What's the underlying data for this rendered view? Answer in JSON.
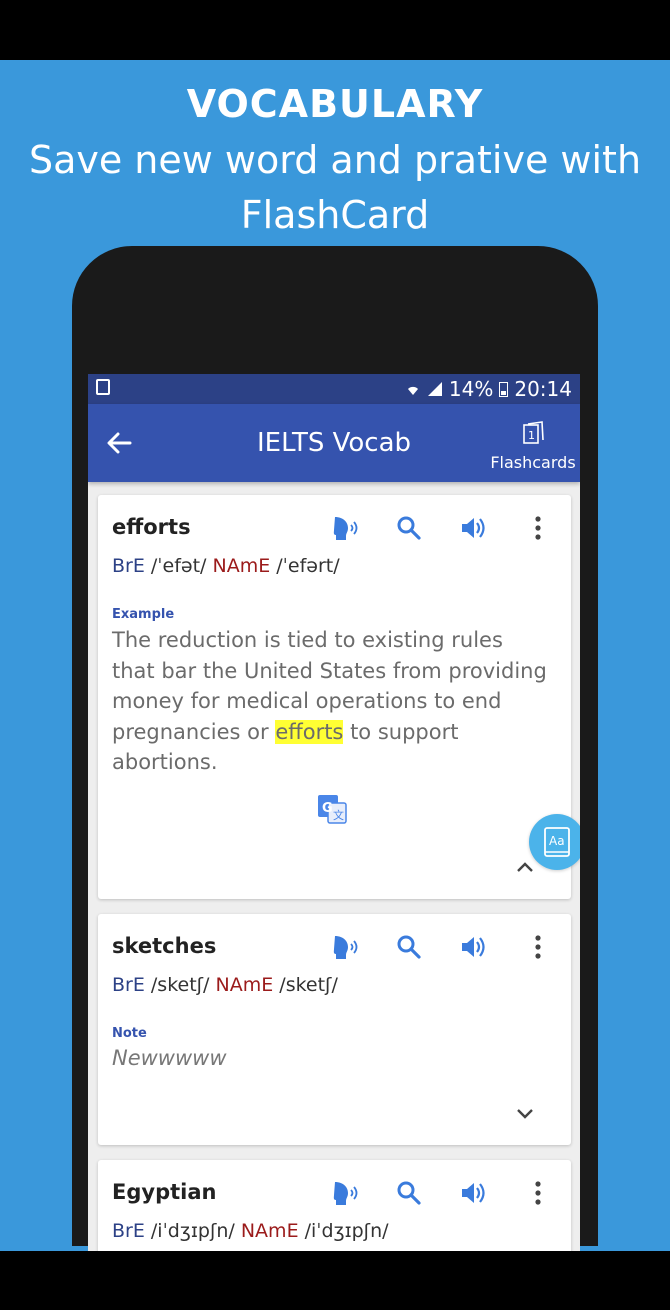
{
  "promo": {
    "title": "VOCABULARY",
    "subtitle_line1": "Save new word and prative with",
    "subtitle_line2": "FlashCard"
  },
  "status_bar": {
    "battery": "14%",
    "time": "20:14"
  },
  "app_bar": {
    "title": "IELTS Vocab",
    "flashcards_label": "Flashcards"
  },
  "cards": [
    {
      "word": "efforts",
      "bre_label": "BrE",
      "bre_ipa": "/ˈefət/",
      "name_label": "NAmE",
      "name_ipa": "/ˈefərt/",
      "section_label": "Example",
      "example_before": "The reduction is tied to existing rules that bar the United States from providing money for medical operations to end pregnancies or",
      "example_highlight": "efforts",
      "example_after": "to support abortions.",
      "expanded": true
    },
    {
      "word": "sketches",
      "bre_label": "BrE",
      "bre_ipa": "/sketʃ/",
      "name_label": "NAmE",
      "name_ipa": "/sketʃ/",
      "section_label": "Note",
      "note": "Newwwww",
      "expanded": false
    },
    {
      "word": "Egyptian",
      "bre_label": "BrE",
      "bre_ipa": "/iˈdʒɪpʃn/",
      "name_label": "NAmE",
      "name_ipa": "/iˈdʒɪpʃn/"
    }
  ],
  "colors": {
    "promo_background": "#3a98db",
    "app_bar": "#3553ae",
    "status_bar": "#2c4186",
    "icon_blue": "#3a7bdc",
    "highlight": "#ffff33",
    "name_red": "#9b1b1b",
    "fab": "#4bb3ea"
  },
  "icons": [
    "back-arrow-icon",
    "flashcards-icon",
    "speech-icon",
    "search-icon",
    "volume-icon",
    "more-vert-icon",
    "google-translate-icon",
    "chevron-up-icon",
    "chevron-down-icon",
    "dictionary-icon"
  ]
}
